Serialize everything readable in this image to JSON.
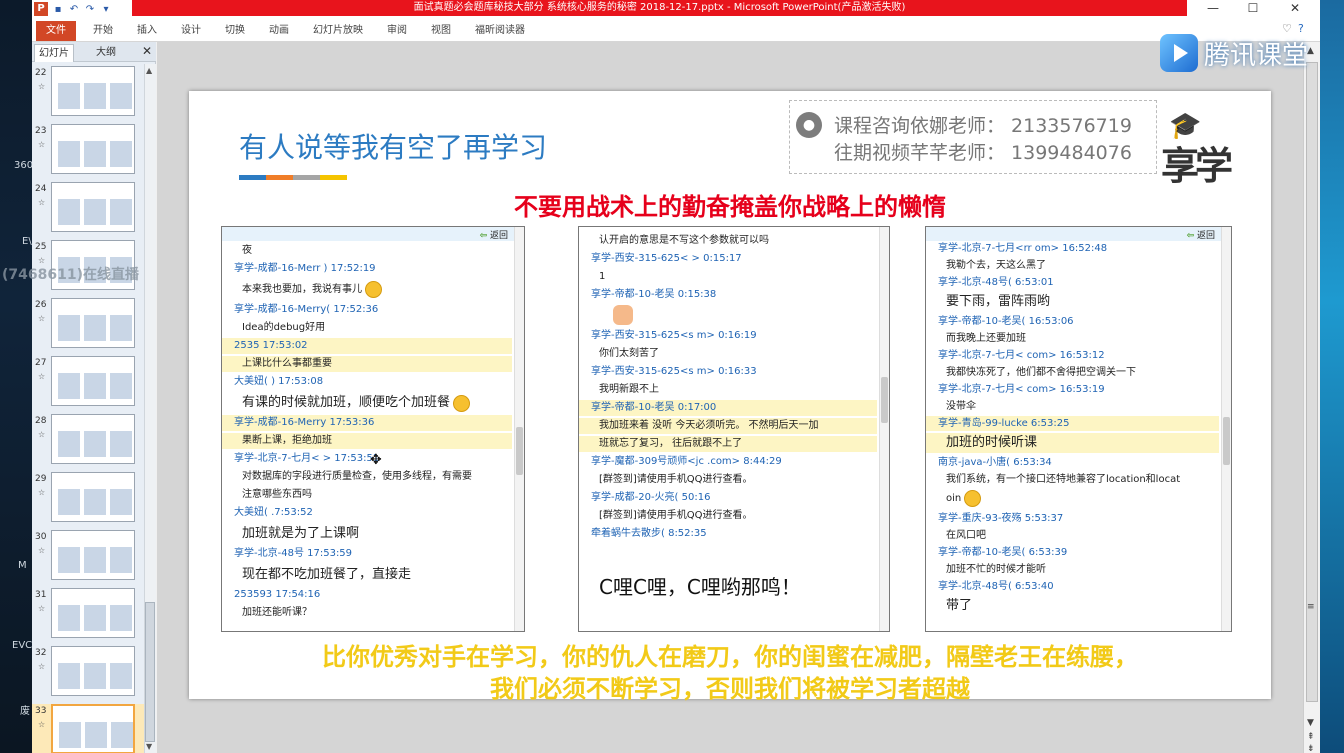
{
  "window": {
    "title": "面试真题必会题库秘技大部分 系统核心服务的秘密 2018-12-17.pptx - Microsoft PowerPoint(产品激活失败)"
  },
  "quick_access": {
    "app_icon": "P"
  },
  "ribbon": {
    "tabs": [
      "文件",
      "开始",
      "插入",
      "设计",
      "切换",
      "动画",
      "幻灯片放映",
      "审阅",
      "视图",
      "福昕阅读器"
    ]
  },
  "watermark": {
    "brand": "腾讯课堂"
  },
  "desktop": {
    "labels": [
      "360",
      "E\\",
      "(7468611)在线直播",
      "EVC",
      "M",
      "废"
    ]
  },
  "slide_panel": {
    "tabs": [
      "幻灯片",
      "大纲"
    ],
    "slides": [
      {
        "num": "22",
        "star": "☆"
      },
      {
        "num": "23",
        "star": "☆"
      },
      {
        "num": "24",
        "star": "☆"
      },
      {
        "num": "25",
        "star": "☆"
      },
      {
        "num": "26",
        "star": "☆"
      },
      {
        "num": "27",
        "star": "☆"
      },
      {
        "num": "28",
        "star": "☆"
      },
      {
        "num": "29",
        "star": "☆"
      },
      {
        "num": "30",
        "star": "☆"
      },
      {
        "num": "31",
        "star": "☆"
      },
      {
        "num": "32",
        "star": "☆"
      },
      {
        "num": "33",
        "star": "☆"
      }
    ],
    "selected": "33"
  },
  "slide": {
    "title": "有人说等我有空了再学习",
    "consult_line1": "课程咨询依娜老师： 2133576719",
    "consult_line2": "往期视频芊芊老师： 1399484076",
    "logo_text": "享学",
    "headline": "不要用战术上的勤奋掩盖你战略上的懒惰",
    "bottom_line1": "比你优秀对手在学习，你的仇人在磨刀，你的闺蜜在减肥，隔壁老王在练腰，",
    "bottom_line2": "我们必须不断学习，否则我们将被学习者超越",
    "accent_colors": [
      "#2c7bc2",
      "#f07d28",
      "#a5a5a5",
      "#f5c400"
    ],
    "chat_back": "返回",
    "chat1": [
      {
        "type": "body",
        "text": "夜"
      },
      {
        "type": "sender",
        "text": "享学-成都-16-Merr                 ) 17:52:19"
      },
      {
        "type": "body",
        "text": "本来我也要加，我说有事儿",
        "emoji": true
      },
      {
        "type": "sender",
        "text": "享学-成都-16-Merry(                17:52:36"
      },
      {
        "type": "body",
        "text": "Idea的debug好用"
      },
      {
        "type": "sender",
        "text": "2535                     17:53:02",
        "hl": true
      },
      {
        "type": "body",
        "text": "上课比什么事都重要",
        "hl": true
      },
      {
        "type": "sender",
        "text": "大美妞(                ) 17:53:08"
      },
      {
        "type": "body",
        "text": "有课的时候就加班，顺便吃个加班餐",
        "emoji": true,
        "big": true
      },
      {
        "type": "sender",
        "text": "享学-成都-16-Merry              17:53:36",
        "hl": true
      },
      {
        "type": "body",
        "text": "果断上课，拒绝加班",
        "hl": true
      },
      {
        "type": "sender",
        "text": "享学-北京-7-七月<                     > 17:53:51"
      },
      {
        "type": "body",
        "text": "对数据库的字段进行质量检查，使用多线程，有需要"
      },
      {
        "type": "body",
        "text": "注意哪些东西吗"
      },
      {
        "type": "sender",
        "text": "大美妞(                .7:53:52"
      },
      {
        "type": "body",
        "text": "加班就是为了上课啊",
        "big": true
      },
      {
        "type": "sender",
        "text": "享学-北京-48号                    17:53:59"
      },
      {
        "type": "body",
        "text": "现在都不吃加班餐了，直接走",
        "big": true
      },
      {
        "type": "sender",
        "text": "253593                    17:54:16"
      },
      {
        "type": "body",
        "text": "加班还能听课？"
      }
    ],
    "chat2": [
      {
        "type": "body",
        "text": "认开启的意思是不写这个参数就可以吗"
      },
      {
        "type": "sender",
        "text": "享学-西安-315-625<                    > 0:15:17"
      },
      {
        "type": "body",
        "text": "1"
      },
      {
        "type": "sender",
        "text": "享学-帝都-10-老吴              0:15:38"
      },
      {
        "type": "body",
        "text": "",
        "hand": true
      },
      {
        "type": "sender",
        "text": "享学-西安-315-625<s                  m> 0:16:19"
      },
      {
        "type": "body",
        "text": "你们太刻苦了"
      },
      {
        "type": "sender",
        "text": "享学-西安-315-625<s                  m> 0:16:33"
      },
      {
        "type": "body",
        "text": "我明新跟不上"
      },
      {
        "type": "sender",
        "text": "享学-帝都-10-老吴                  0:17:00",
        "hl": true
      },
      {
        "type": "body",
        "text": "我加班来着 没听 今天必须听完。 不然明后天一加",
        "hl": true
      },
      {
        "type": "body",
        "text": "班就忘了复习， 往后就跟不上了",
        "hl": true
      },
      {
        "type": "sender",
        "text": "享学-魔都-309号顽师<jc                 .com> 8:44:29"
      },
      {
        "type": "body",
        "text": "[群签到]请使用手机QQ进行查看。"
      },
      {
        "type": "sender",
        "text": "享学-成都-20-火亮(                   50:16"
      },
      {
        "type": "body",
        "text": "[群签到]请使用手机QQ进行查看。"
      },
      {
        "type": "sender",
        "text": "牵着蜗牛去散步(                   8:52:35"
      }
    ],
    "chat2_sticker": "C哩C哩，C哩哟那鸣！",
    "chat3": [
      {
        "type": "sender",
        "text": "享学-北京-7-七月<rr              om> 16:52:48"
      },
      {
        "type": "body",
        "text": "我勒个去，天这么黑了"
      },
      {
        "type": "sender",
        "text": "享学-北京-48号(                  6:53:01"
      },
      {
        "type": "body",
        "text": "要下雨，雷阵雨哟",
        "big": true
      },
      {
        "type": "sender",
        "text": "享学-帝都-10-老吴(                 16:53:06"
      },
      {
        "type": "body",
        "text": "而我晚上还要加班"
      },
      {
        "type": "sender",
        "text": "享学-北京-7-七月<                  com> 16:53:12"
      },
      {
        "type": "body",
        "text": "我都快冻死了，他们都不舍得把空调关一下"
      },
      {
        "type": "sender",
        "text": "享学-北京-7-七月<                  com> 16:53:19"
      },
      {
        "type": "body",
        "text": "没带伞"
      },
      {
        "type": "sender",
        "text": "享学-青岛-99-lucke                  6:53:25",
        "hl": true
      },
      {
        "type": "body",
        "text": "加班的时候听课",
        "hl": true,
        "big": true
      },
      {
        "type": "sender",
        "text": "南京-java-小唐(                     6:53:34"
      },
      {
        "type": "body",
        "text": "我们系统，有一个接口还特地兼容了location和locat"
      },
      {
        "type": "body",
        "text": "oin",
        "emoji": true
      },
      {
        "type": "sender",
        "text": "享学-重庆-93-夜殇                   5:53:37"
      },
      {
        "type": "body",
        "text": "在风口吧"
      },
      {
        "type": "sender",
        "text": "享学-帝都-10-老吴(                  6:53:39"
      },
      {
        "type": "body",
        "text": "加班不忙的时候才能听"
      },
      {
        "type": "sender",
        "text": "享学-北京-48号(                    6:53:40"
      },
      {
        "type": "body",
        "text": "带了",
        "big": true
      }
    ]
  }
}
